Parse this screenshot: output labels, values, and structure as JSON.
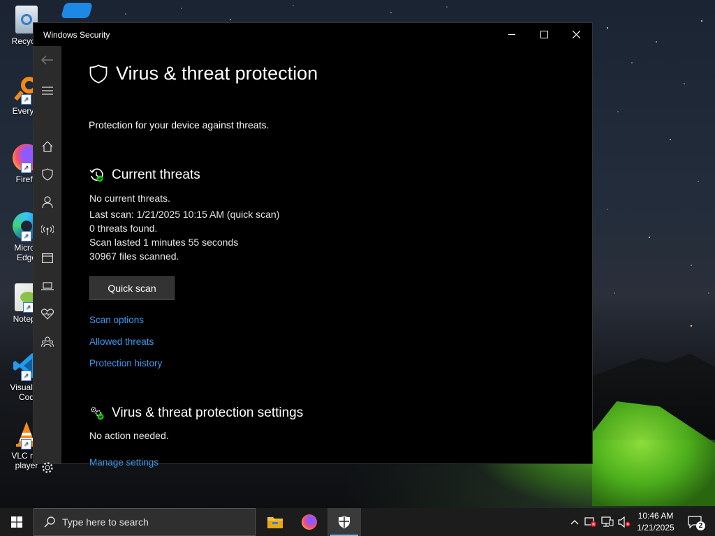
{
  "desktop": {
    "icons": [
      {
        "label": "Recycle",
        "icon": "recycle-bin-icon"
      },
      {
        "label": "Everyth",
        "icon": "everything-search-icon"
      },
      {
        "label": "Firefo",
        "icon": "firefox-icon"
      },
      {
        "label": "Micros\nEdge",
        "icon": "edge-icon"
      },
      {
        "label": "Notepa",
        "icon": "notepad-plus-icon"
      },
      {
        "label": "Visual St\nCod",
        "icon": "vscode-icon"
      },
      {
        "label": "VLC me\nplayer",
        "icon": "vlc-icon"
      }
    ]
  },
  "window": {
    "title": "Windows Security",
    "controls": {
      "minimize": "minimize-icon",
      "maximize": "maximize-icon",
      "close": "close-icon"
    }
  },
  "nav": {
    "items": [
      "back-arrow-icon",
      "hamburger-menu-icon",
      "home-icon",
      "shield-icon",
      "account-icon",
      "wifi-antenna-icon",
      "app-browser-icon",
      "laptop-icon",
      "heart-health-icon",
      "family-icon",
      "settings-gear-icon"
    ]
  },
  "page": {
    "title": "Virus & threat protection",
    "subtitle": "Protection for your device against threats."
  },
  "current_threats": {
    "heading": "Current threats",
    "status": "No current threats.",
    "last_scan": "Last scan: 1/21/2025 10:15 AM (quick scan)",
    "threats_found": "0 threats found.",
    "scan_duration": "Scan lasted 1 minutes 55 seconds",
    "files_scanned": "30967 files scanned.",
    "quick_scan_label": "Quick scan",
    "links": {
      "scan_options": "Scan options",
      "allowed_threats": "Allowed threats",
      "protection_history": "Protection history"
    }
  },
  "settings_section": {
    "heading": "Virus & threat protection settings",
    "status": "No action needed.",
    "manage_link": "Manage settings"
  },
  "taskbar": {
    "search_placeholder": "Type here to search",
    "time": "10:46 AM",
    "date": "1/21/2025",
    "notification_count": "2"
  },
  "colors": {
    "link": "#3b9bf2",
    "window_bg": "#000000",
    "nav_bg": "#2b2b2b",
    "ok_green": "#16c60c",
    "taskbar_bg": "#1c1c1c"
  }
}
